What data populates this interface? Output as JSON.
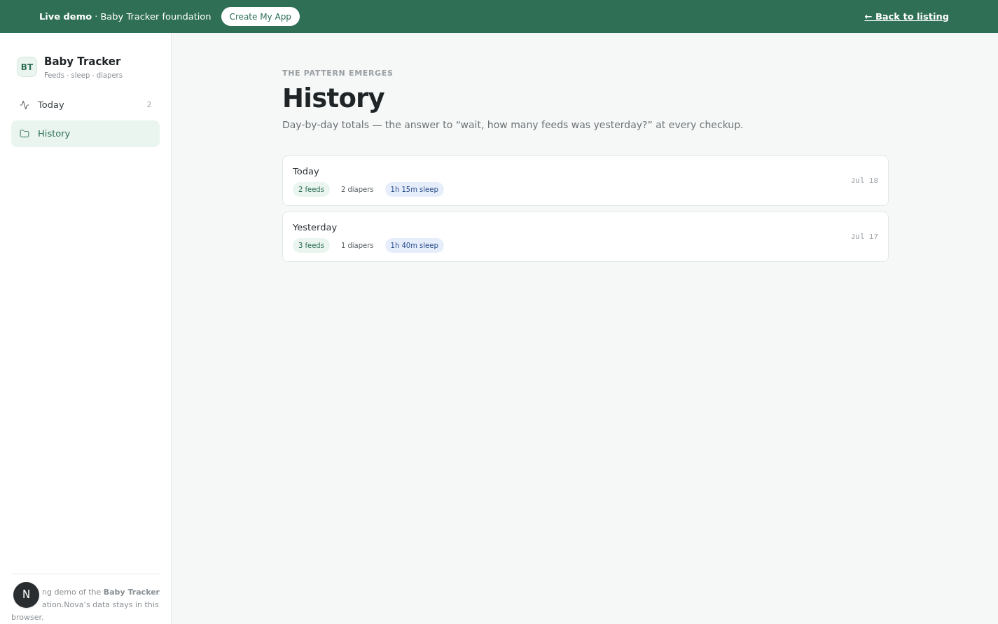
{
  "banner": {
    "lead": "Live demo",
    "text": "· Baby Tracker foundation",
    "cta": "Create My App",
    "back_link": "← Back to listing"
  },
  "sidebar": {
    "logo": "BT",
    "app_name": "Baby Tracker",
    "tagline": "Feeds · sleep · diapers",
    "items": [
      {
        "label": "Today",
        "count": "2",
        "selected": false
      },
      {
        "label": "History",
        "selected": true
      }
    ],
    "footer_lines": [
      "ng demo of the **Baby Tracker**",
      "ation.Nova’s data stays in this",
      "browser."
    ],
    "badge": "N"
  },
  "page": {
    "eyebrow": "THE PATTERN EMERGES",
    "title": "History",
    "subtitle": "Day-by-day totals — the answer to “wait, how many feeds was yesterday?” at every checkup.",
    "days": [
      {
        "label": "Today",
        "feeds": "2 feeds",
        "diapers": "2 diapers",
        "sleep": "1h 15m sleep",
        "date": "Jul 18"
      },
      {
        "label": "Yesterday",
        "feeds": "3 feeds",
        "diapers": "1 diapers",
        "sleep": "1h 40m sleep",
        "date": "Jul 17"
      }
    ]
  }
}
